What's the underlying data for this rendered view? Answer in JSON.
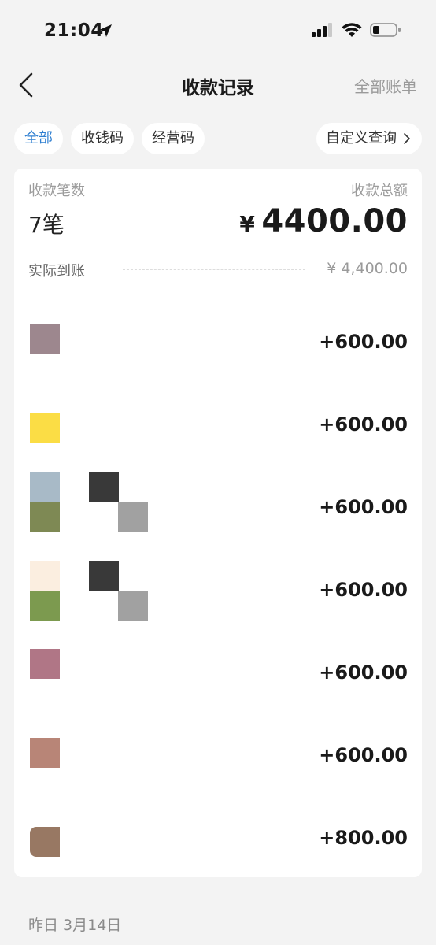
{
  "status": {
    "time": "21:04"
  },
  "nav": {
    "title": "收款记录",
    "right_label": "全部账单"
  },
  "filters": {
    "tabs": [
      {
        "label": "全部"
      },
      {
        "label": "收钱码"
      },
      {
        "label": "经营码"
      }
    ],
    "custom_label": "自定义查询"
  },
  "summary": {
    "count_label": "收款笔数",
    "count_value": "7笔",
    "total_label": "收款总额",
    "currency": "¥",
    "total_value": "4400.00",
    "net_label": "实际到账",
    "net_value": "¥ 4,400.00"
  },
  "transactions": [
    {
      "amount": "+600.00"
    },
    {
      "amount": "+600.00"
    },
    {
      "amount": "+600.00"
    },
    {
      "amount": "+600.00"
    },
    {
      "amount": "+600.00"
    },
    {
      "amount": "+600.00"
    },
    {
      "amount": "+800.00"
    }
  ],
  "section_date": "昨日  3月14日",
  "colors": {
    "accent": "#2f7fd1",
    "background": "#f3f3f3"
  }
}
